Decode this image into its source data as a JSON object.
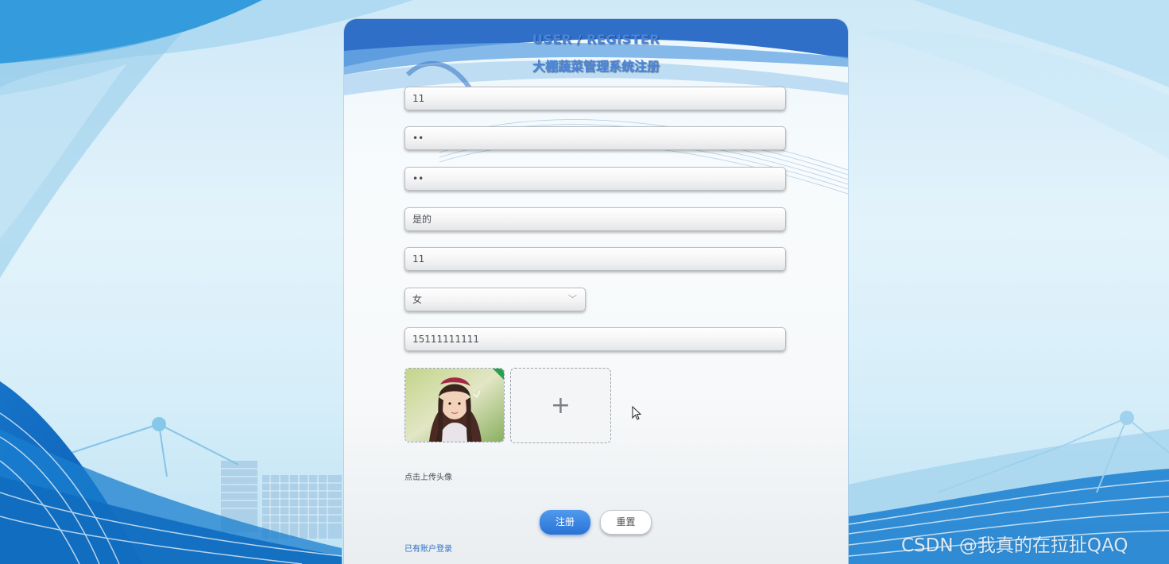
{
  "header": {
    "title_en": "USER / REGISTER",
    "title_cn": "大棚蔬菜管理系统注册"
  },
  "form": {
    "fields": [
      {
        "value": "11"
      },
      {
        "value": "••"
      },
      {
        "value": "••"
      },
      {
        "value": "是的"
      },
      {
        "value": "11"
      },
      {
        "value": "女",
        "type": "select",
        "chevron_icon": "chevron-down-icon"
      },
      {
        "value": "15111111111"
      }
    ],
    "avatar_upload_icon": "plus-icon",
    "upload_hint": "点击上传头像",
    "register_label": "注册",
    "reset_label": "重置",
    "login_link": "已有账户登录"
  },
  "watermark": "CSDN @我真的在拉扯QAQ",
  "colors": {
    "accent": "#2a73d6",
    "title": "#4a86d8",
    "link": "#2f6fc4"
  }
}
